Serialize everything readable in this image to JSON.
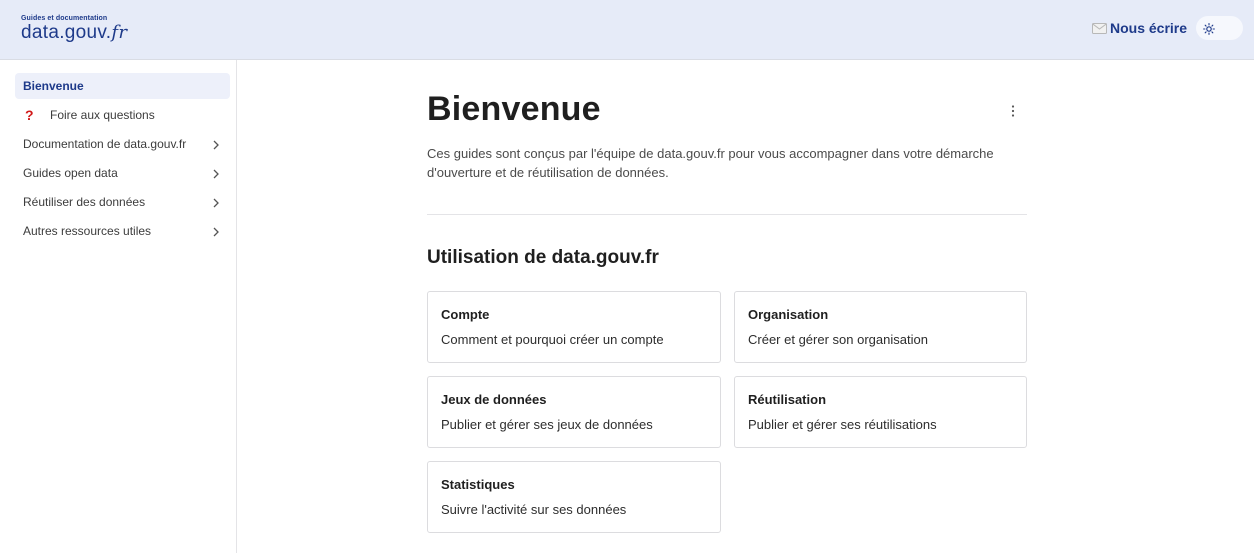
{
  "header": {
    "logo_subtitle": "Guides et documentation",
    "logo_main": "data",
    "logo_dot": ".",
    "logo_gouv": "gouv.",
    "logo_fr": "fr",
    "contact_label": "Nous écrire",
    "icons": {
      "contact": "mail-icon",
      "theme": "sun-icon"
    }
  },
  "sidebar": {
    "items": [
      {
        "label": "Bienvenue",
        "active": true
      },
      {
        "label": "Foire aux questions",
        "icon": "?"
      },
      {
        "label": "Documentation de data.gouv.fr",
        "expandable": true
      },
      {
        "label": "Guides open data",
        "expandable": true
      },
      {
        "label": "Réutiliser des données",
        "expandable": true
      },
      {
        "label": "Autres ressources utiles",
        "expandable": true
      }
    ]
  },
  "main": {
    "title": "Bienvenue",
    "intro": "Ces guides sont conçus par l'équipe de data.gouv.fr pour vous accompagner dans votre démarche d'ouverture et de réutilisation de données.",
    "section_title": "Utilisation de data.gouv.fr",
    "cards": [
      {
        "title": "Compte",
        "description": "Comment et pourquoi créer un compte"
      },
      {
        "title": "Organisation",
        "description": "Créer et gérer son organisation"
      },
      {
        "title": "Jeux de données",
        "description": "Publier et gérer ses jeux de données"
      },
      {
        "title": "Réutilisation",
        "description": "Publier et gérer ses réutilisations"
      },
      {
        "title": "Statistiques",
        "description": "Suivre l'activité sur ses données"
      }
    ]
  },
  "colors": {
    "header_bg": "#e6ebf8",
    "brand_blue": "#1e3a8a",
    "active_bg": "#edf0fa",
    "faq_icon": "#d11a1a"
  }
}
